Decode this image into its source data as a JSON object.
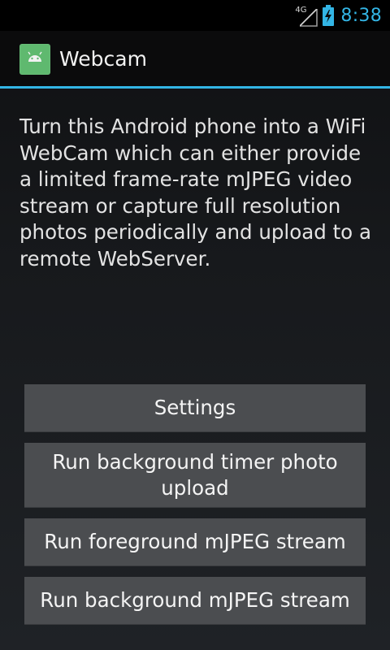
{
  "status_bar": {
    "network_type": "4G",
    "time": "8:38",
    "icons": [
      "signal-icon",
      "battery-charging-icon"
    ]
  },
  "action_bar": {
    "title": "Webcam",
    "icon": "android-icon",
    "accent_color": "#33b5e5"
  },
  "description": "Turn this Android phone into a WiFi WebCam which can either provide a limited frame-rate mJPEG video stream or capture full resolution photos periodically and upload to a remote WebServer.",
  "buttons": {
    "settings": "Settings",
    "timer_upload": "Run background timer photo upload",
    "foreground_stream": "Run foreground mJPEG stream",
    "background_stream": "Run background mJPEG stream"
  }
}
